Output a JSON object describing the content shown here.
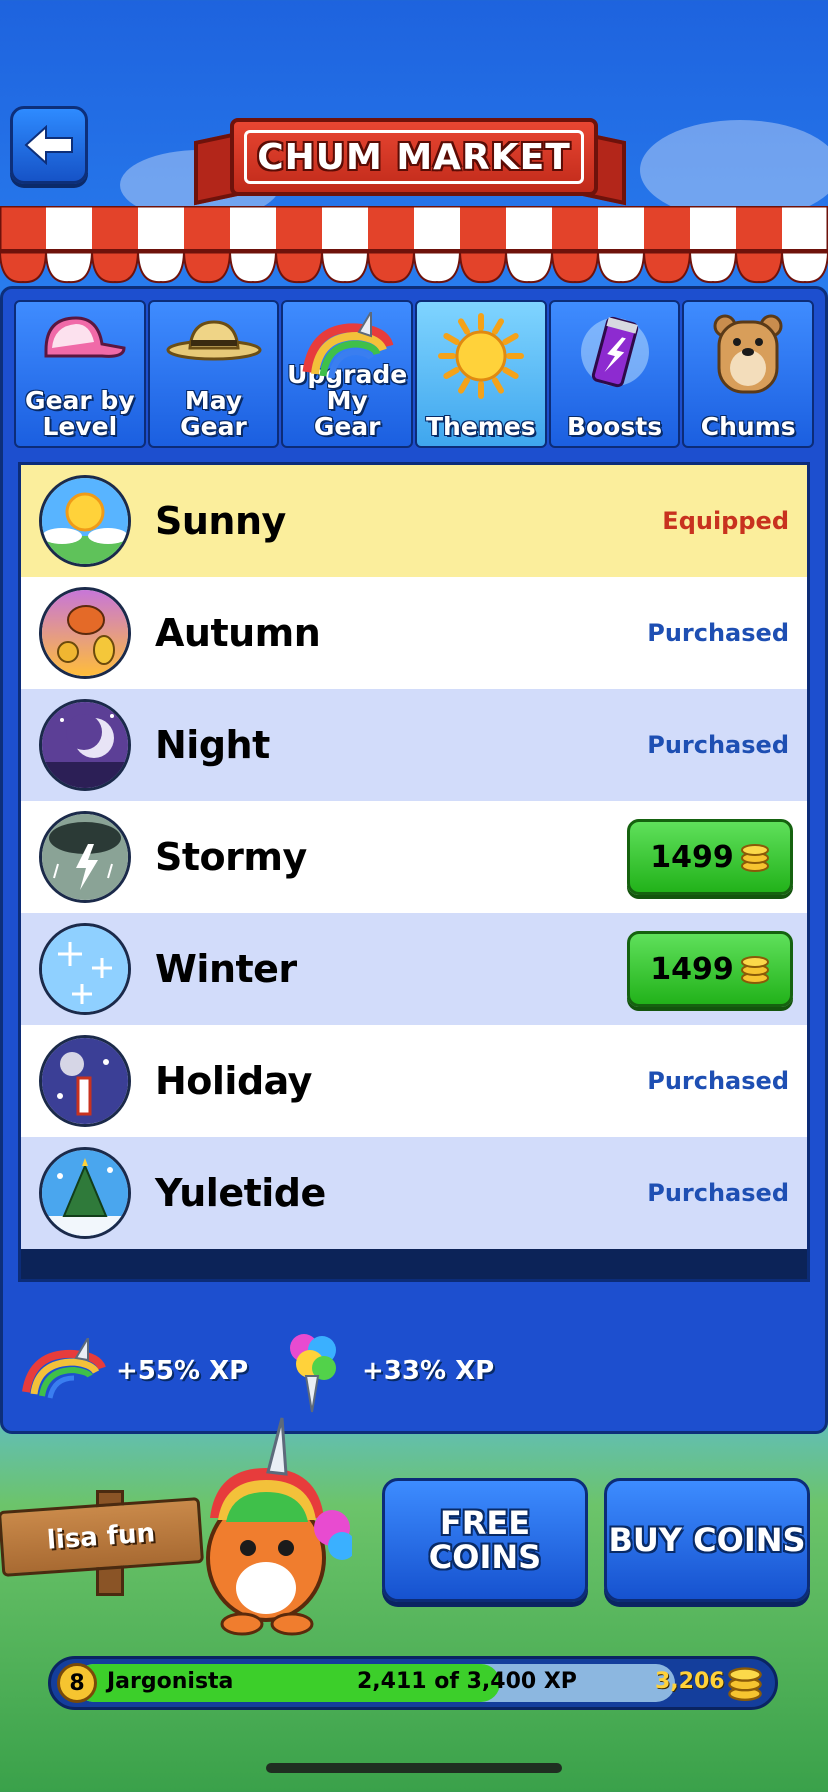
{
  "header": {
    "title": "CHUM MARKET",
    "back_icon": "arrow-left-icon"
  },
  "tabs": [
    {
      "label": "Gear by Level",
      "icon": "cap-icon",
      "active": false
    },
    {
      "label": "May Gear",
      "icon": "straw-hat-icon",
      "active": false
    },
    {
      "label": "Upgrade My Gear",
      "icon": "rainbow-horn-icon",
      "active": false
    },
    {
      "label": "Themes",
      "icon": "sun-icon",
      "active": true
    },
    {
      "label": "Boosts",
      "icon": "energy-can-icon",
      "active": false
    },
    {
      "label": "Chums",
      "icon": "bear-icon",
      "active": false
    }
  ],
  "themes": [
    {
      "name": "Sunny",
      "status": "Equipped",
      "price": null
    },
    {
      "name": "Autumn",
      "status": "Purchased",
      "price": null
    },
    {
      "name": "Night",
      "status": "Purchased",
      "price": null
    },
    {
      "name": "Stormy",
      "status": null,
      "price": "1499"
    },
    {
      "name": "Winter",
      "status": null,
      "price": "1499"
    },
    {
      "name": "Holiday",
      "status": "Purchased",
      "price": null
    },
    {
      "name": "Yuletide",
      "status": "Purchased",
      "price": null
    }
  ],
  "xp_boosts": [
    {
      "icon": "rainbow-horn-icon",
      "text": "+55% XP"
    },
    {
      "icon": "rainbow-cotton-candy-icon",
      "text": "+33% XP"
    }
  ],
  "player": {
    "sign_name": "lisa fun",
    "level": "8",
    "rank": "Jargonista",
    "xp_text": "2,411 of 3,400 XP",
    "xp_fraction": 0.709,
    "coins": "3,206"
  },
  "buttons": {
    "free_coins": "FREE COINS",
    "buy_coins": "BUY COINS"
  },
  "colors": {
    "equipped": "#c8321f",
    "purchased": "#1e4fb3",
    "row_highlight": "#fbee9c",
    "row_alt": "#d2dcfa",
    "row_white": "#ffffff"
  }
}
